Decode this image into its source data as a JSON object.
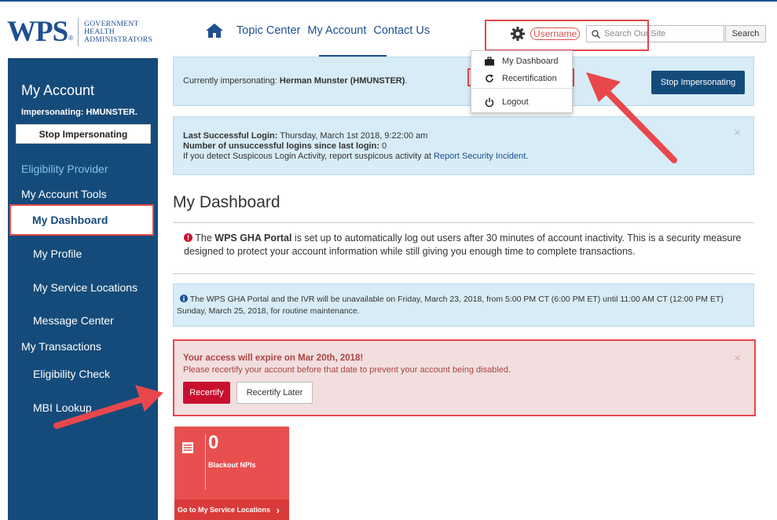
{
  "header": {
    "logo": {
      "wps": "WPS",
      "reg": "®",
      "sub_lines": [
        "GOVERNMENT",
        "HEALTH",
        "ADMINISTRATORS"
      ]
    },
    "nav": [
      {
        "label": "Topic Center"
      },
      {
        "label": "My Account"
      },
      {
        "label": "Contact Us"
      }
    ],
    "username": "Username",
    "search": {
      "placeholder": "Search Our Site",
      "button": "Search"
    }
  },
  "dropdown": {
    "items": [
      {
        "label": "My Dashboard",
        "icon": "briefcase-icon"
      },
      {
        "label": "Recertification",
        "icon": "refresh-icon"
      },
      {
        "label": "Logout",
        "icon": "power-icon"
      }
    ]
  },
  "sidebar": {
    "title": "My Account",
    "impersonating": "Impersonating: HMUNSTER.",
    "stop_button": "Stop Impersonating",
    "eligibility": "Eligibility Provider",
    "tools_heading": "My Account Tools",
    "tools": [
      {
        "label": "My Dashboard"
      },
      {
        "label": "My Profile"
      },
      {
        "label": "My Service Locations"
      },
      {
        "label": "Message Center"
      }
    ],
    "transactions_heading": "My Transactions",
    "transactions": [
      {
        "label": "Eligibility Check"
      },
      {
        "label": "MBI Lookup"
      }
    ]
  },
  "impersonation_banner": {
    "prefix": "Currently impersonating: ",
    "name": "Herman Munster (HMUNSTER)",
    "suffix": ".",
    "button": "Stop Impersonating"
  },
  "login_banner": {
    "last_login_label": "Last Successful Login:",
    "last_login_value": " Thursday, March 1st 2018, 9:22:00 am",
    "failed_label": "Number of unsuccessful logins since last login:",
    "failed_value": " 0",
    "suspicious_text": "If you detect Suspicous Login Activity, report suspicous activity at ",
    "suspicious_link": "Report Security Incident",
    "suspicious_end": ".",
    "close": "×"
  },
  "dashboard": {
    "title": "My Dashboard",
    "notice_pre": " The ",
    "notice_bold": "WPS GHA Portal",
    "notice_post": " is set up to automatically log out users after 30 minutes of account inactivity. This is a security measure designed to protect your account information while still giving you enough time to complete transactions.",
    "maintenance": " The WPS GHA Portal and the IVR will be unavailable on Friday, March 23, 2018, from 5:00 PM CT (6:00 PM ET) until 11:00 AM CT (12:00 PM ET) Sunday, March 25, 2018, for routine maintenance."
  },
  "expiry_alert": {
    "title": "Your access will expire on Mar 20th, 2018!",
    "text": "Please recertify your account before that date to prevent your account being disabled.",
    "recertify": "Recertify",
    "later": "Recertify Later",
    "close": "×"
  },
  "tile": {
    "count": "0",
    "label": "Blackout NPIs",
    "footer": "Go to My Service Locations",
    "chevron": "›"
  },
  "colors": {
    "brand": "#1d4f91",
    "sidebar": "#154b7a",
    "annotation": "#e8474b",
    "tile": "#e8504f"
  }
}
